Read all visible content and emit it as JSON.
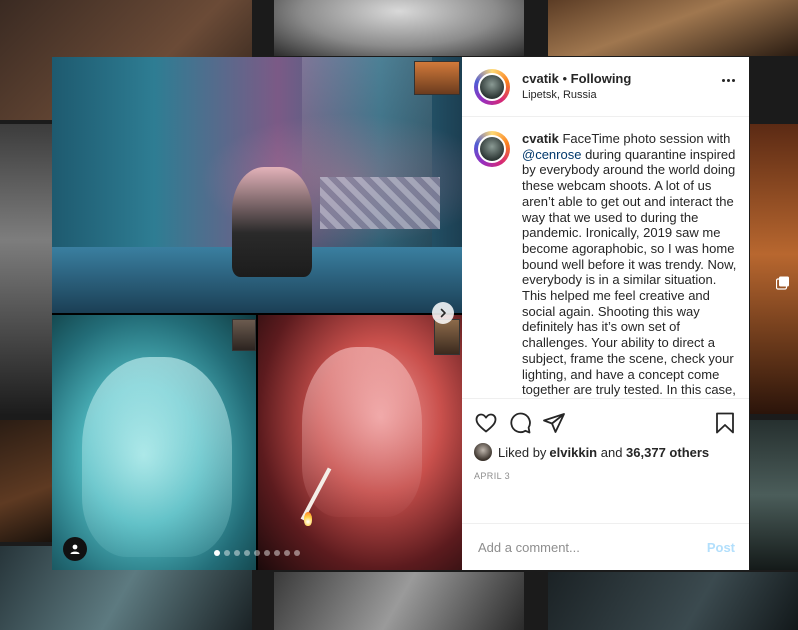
{
  "post": {
    "username": "cvatik",
    "separator": " • ",
    "follow_status": "Following",
    "location": "Lipetsk, Russia",
    "caption": {
      "username": "cvatik",
      "text_before_mention": " FaceTime photo session with ",
      "mention": "@cenrose",
      "text_after_mention": " during quarantine inspired by everybody around the world doing these webcam shoots. A lot of us aren’t able to get out and interact the way that we used to during the pandemic. Ironically, 2019 saw me become agoraphobic, so I was home bound well before it was trendy. Now, everybody is in a similar situation. This helped me feel creative and social again. Shooting this way definitely has it’s own set of challenges. Your ability to direct a subject, frame the scene, check your lighting, and have a concept come together are truly tested. In this case, there was a huge time difference between our two countries, as well as a language barrier. Using google translate with each other definitely"
    },
    "likes": {
      "prefix": "Liked by ",
      "liker": "elvikkin",
      "middle": " and ",
      "others": "36,377 others"
    },
    "date": "APRIL 3",
    "comment": {
      "placeholder": "Add a comment...",
      "post_label": "Post"
    },
    "carousel": {
      "slide_count": 9,
      "active_index": 0
    }
  },
  "colors": {
    "text": "#262626",
    "secondary": "#8e8e8e",
    "link": "#00376b",
    "post_button_disabled": "#b2dffc",
    "border": "#efefef"
  },
  "icons": [
    "more-options-icon",
    "heart-icon",
    "comment-icon",
    "share-icon",
    "bookmark-icon",
    "chevron-right-icon",
    "user-tag-icon",
    "multi-photo-icon"
  ]
}
